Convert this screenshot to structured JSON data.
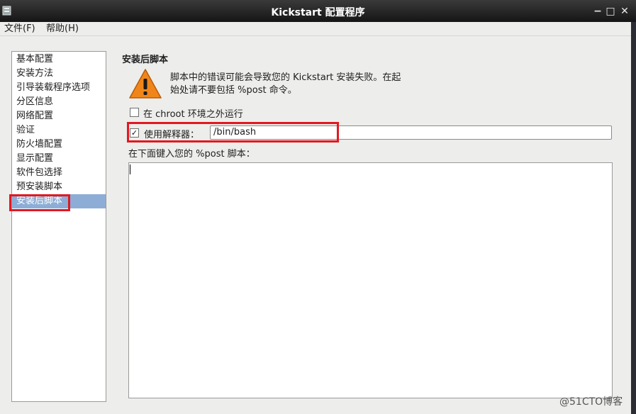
{
  "window": {
    "title": "Kickstart 配置程序",
    "controls": [
      "minimize-icon",
      "maximize-icon",
      "close-icon"
    ]
  },
  "menubar": {
    "items": [
      "文件(F)",
      "帮助(H)"
    ]
  },
  "sidebar": {
    "items": [
      "基本配置",
      "安装方法",
      "引导装载程序选项",
      "分区信息",
      "网络配置",
      "验证",
      "防火墙配置",
      "显示配置",
      "软件包选择",
      "预安装脚本",
      "安装后脚本"
    ],
    "selected_index": 10
  },
  "main": {
    "section_title": "安装后脚本",
    "warning": {
      "icon": "warning-icon",
      "line1": "脚本中的错误可能会导致您的  Kickstart  安装失败。在起",
      "line2": "始处请不要包括 %post 命令。"
    },
    "chroot_checkbox": {
      "label": "在  chroot 环境之外运行",
      "checked": false
    },
    "interpreter_checkbox": {
      "label": "使用解释器：",
      "checked": true,
      "check_glyph": "✓"
    },
    "interpreter_value": "/bin/bash",
    "script_label": "在下面键入您的 %post 脚本：",
    "script_text": ""
  },
  "watermark": "@51CTO博客",
  "colors": {
    "selection": "#8dadd6",
    "highlight": "#e2191f",
    "warning": "#f0861a"
  }
}
